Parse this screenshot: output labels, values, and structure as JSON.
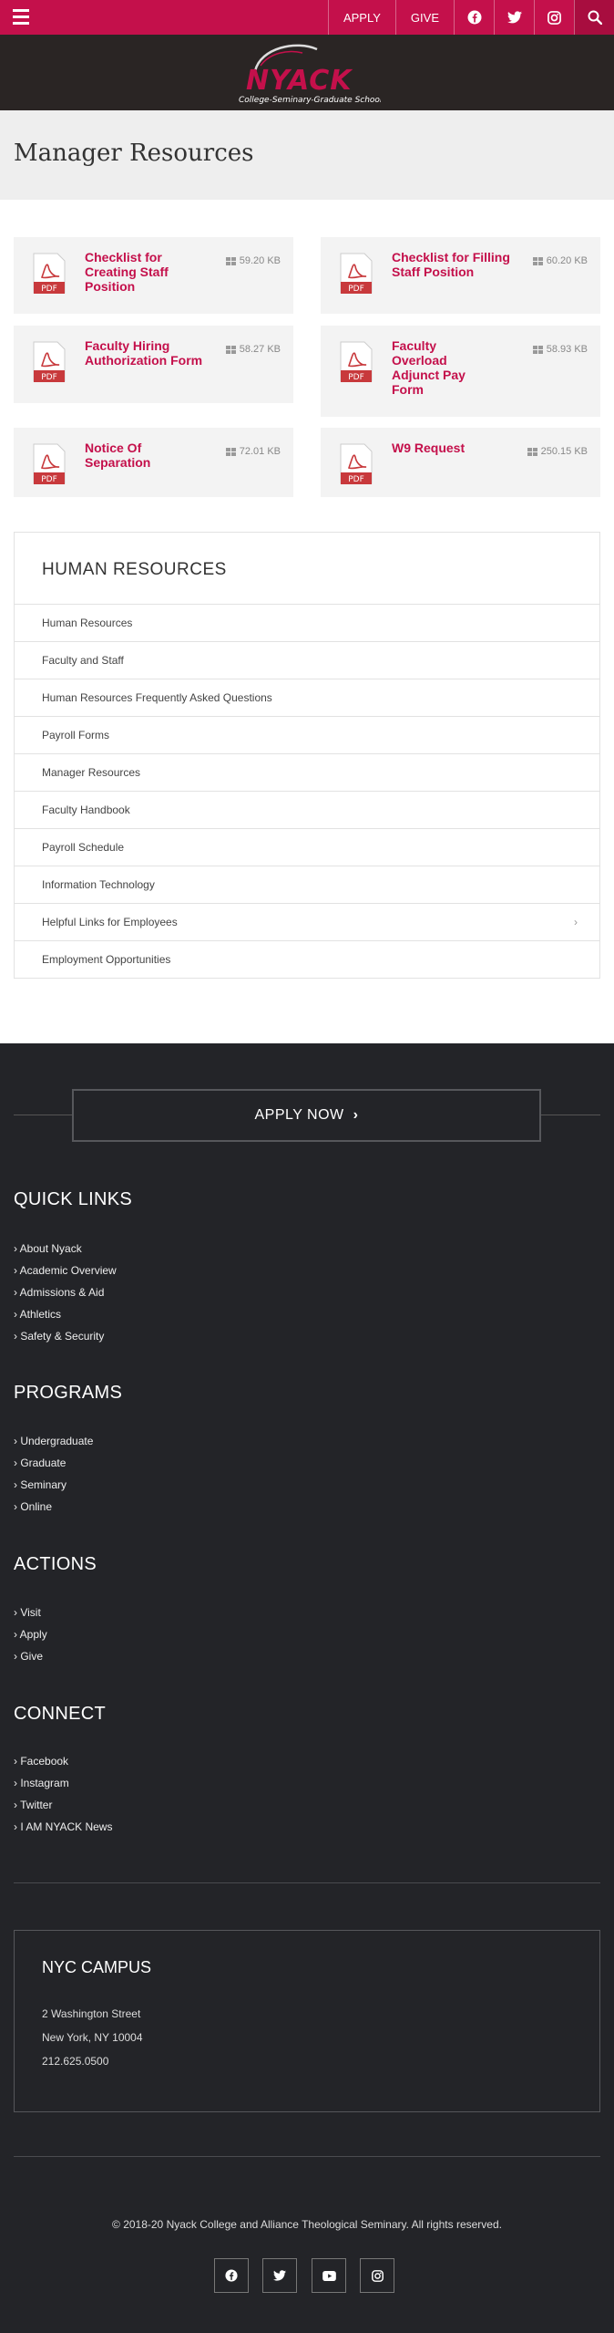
{
  "topbar": {
    "apply_label": "APPLY",
    "give_label": "GIVE",
    "icons": [
      "facebook-icon",
      "twitter-icon",
      "instagram-icon",
      "search-icon"
    ]
  },
  "logo": {
    "name": "NYACK",
    "tagline": "College-Seminary-Graduate Schools"
  },
  "page": {
    "title": "Manager Resources"
  },
  "documents": [
    {
      "title": "Checklist for Creating Staff Position",
      "size": "59.20 KB",
      "icon_label": "PDF"
    },
    {
      "title": "Checklist for Filling Staff Position",
      "size": "60.20 KB",
      "icon_label": "PDF"
    },
    {
      "title": "Faculty Hiring Authorization Form",
      "size": "58.27 KB",
      "icon_label": "PDF"
    },
    {
      "title": "Faculty Overload Adjunct Pay Form",
      "size": "58.93 KB",
      "icon_label": "PDF"
    },
    {
      "title": "Notice Of Separation",
      "size": "72.01 KB",
      "icon_label": "PDF"
    },
    {
      "title": "W9 Request",
      "size": "250.15 KB",
      "icon_label": "PDF"
    }
  ],
  "hr_nav": {
    "heading": "HUMAN RESOURCES",
    "items": [
      "Human Resources",
      "Faculty and Staff",
      "Human Resources Frequently Asked Questions",
      "Payroll Forms",
      "Manager Resources",
      "Faculty Handbook",
      "Payroll Schedule",
      "Information Technology",
      "Helpful Links for Employees",
      "Employment Opportunities"
    ]
  },
  "footer": {
    "apply_now": "APPLY NOW",
    "quick_links": {
      "title": "QUICK LINKS",
      "links": [
        "About Nyack",
        "Academic Overview",
        "Admissions & Aid",
        "Athletics",
        "Safety & Security"
      ]
    },
    "programs": {
      "title": "PROGRAMS",
      "links": [
        "Undergraduate",
        "Graduate",
        "Seminary",
        "Online"
      ]
    },
    "actions": {
      "title": "ACTIONS",
      "links": [
        "Visit",
        "Apply",
        "Give"
      ]
    },
    "connect": {
      "title": "CONNECT",
      "links": [
        "Facebook",
        "Instagram",
        "Twitter",
        "I AM NYACK News"
      ]
    },
    "campus": {
      "title": "NYC CAMPUS",
      "street": "2 Washington Street",
      "city": "New York, NY 10004",
      "phone": "212.625.0500"
    },
    "copyright": "© 2018-20 Nyack College and Alliance Theological Seminary. All rights reserved.",
    "social_icons": [
      "facebook-icon",
      "twitter-icon",
      "youtube-icon",
      "instagram-icon"
    ]
  },
  "colors": {
    "brand": "#c4104b",
    "logoband": "#2a2524",
    "footer": "#232428",
    "header_bg": "#eeeeee"
  }
}
